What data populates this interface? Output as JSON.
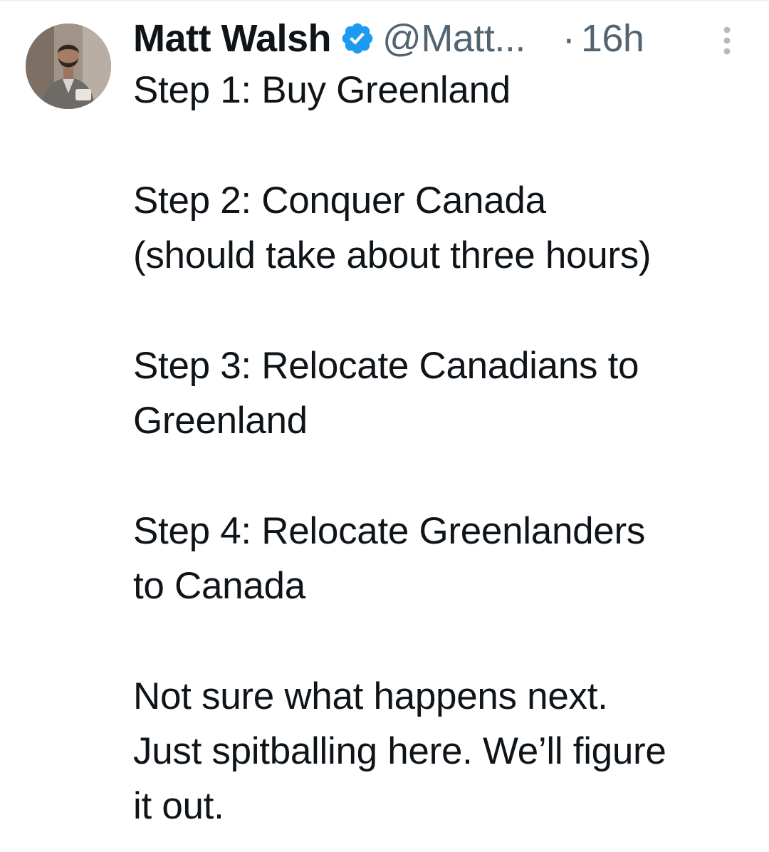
{
  "tweet": {
    "author": {
      "display_name": "Matt Walsh",
      "handle": "@Matt...",
      "verified_icon": "verified-badge-icon",
      "avatar_icon": "avatar"
    },
    "separator": "·",
    "timestamp": "16h",
    "more_icon": "more-options-icon",
    "paragraphs": [
      {
        "lines": [
          "Step 1: Buy Greenland"
        ]
      },
      {
        "lines": [
          "Step 2: Conquer Canada",
          "(should take about three hours)"
        ]
      },
      {
        "lines": [
          "Step 3: Relocate Canadians to",
          "Greenland"
        ]
      },
      {
        "lines": [
          "Step 4: Relocate Greenlanders",
          "to Canada"
        ]
      },
      {
        "lines": [
          "Not sure what happens next.",
          "Just spitballing here. We’ll figure",
          "it out."
        ]
      }
    ]
  },
  "colors": {
    "text_primary": "#0f1419",
    "text_secondary": "#536471",
    "verified_blue": "#1d9bf0",
    "divider": "#eff3f4"
  }
}
